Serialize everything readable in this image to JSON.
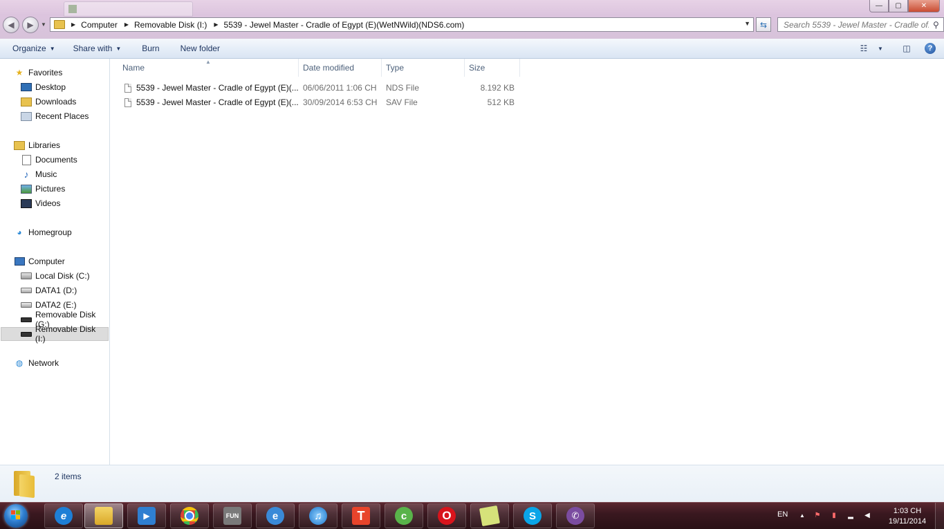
{
  "window": {
    "controls": {
      "minimize": "—",
      "maximize": "▢",
      "close": "✕"
    }
  },
  "address_bar": {
    "crumbs": [
      "Computer",
      "Removable Disk (I:)",
      "5539 - Jewel Master - Cradle of Egypt (E)(WetNWild)(NDS6.com)"
    ]
  },
  "search": {
    "placeholder": "Search 5539 - Jewel Master - Cradle of..."
  },
  "toolbar": {
    "organize": "Organize",
    "share_with": "Share with",
    "burn": "Burn",
    "new_folder": "New folder"
  },
  "nav_pane": {
    "favorites": "Favorites",
    "desktop": "Desktop",
    "downloads": "Downloads",
    "recent_places": "Recent Places",
    "libraries": "Libraries",
    "documents": "Documents",
    "music": "Music",
    "pictures": "Pictures",
    "videos": "Videos",
    "homegroup": "Homegroup",
    "computer": "Computer",
    "local_disk_c": "Local Disk (C:)",
    "data1_d": "DATA1 (D:)",
    "data2_e": "DATA2 (E:)",
    "removable_g": "Removable Disk (G:)",
    "removable_i": "Removable Disk (I:)",
    "network": "Network"
  },
  "columns": {
    "name": "Name",
    "date_modified": "Date modified",
    "type": "Type",
    "size": "Size"
  },
  "files": [
    {
      "name": "5539 - Jewel Master - Cradle of Egypt (E)(...",
      "date": "06/06/2011 1:06 CH",
      "type": "NDS File",
      "size": "8.192 KB"
    },
    {
      "name": "5539 - Jewel Master - Cradle of Egypt (E)(...",
      "date": "30/09/2014 6:53 CH",
      "type": "SAV File",
      "size": "512 KB"
    }
  ],
  "details": {
    "item_count": "2 items"
  },
  "taskbar": {
    "lang": "EN",
    "time": "1:03 CH",
    "date": "19/11/2014",
    "apps": [
      {
        "name": "internet-explorer",
        "glyph": "e",
        "color": "#1e7fd6"
      },
      {
        "name": "windows-explorer",
        "glyph": "",
        "color": "#e8c24f"
      },
      {
        "name": "media-player",
        "glyph": "▶",
        "color": "#2f7fd1"
      },
      {
        "name": "chrome",
        "glyph": "",
        "color": "#3cba54"
      },
      {
        "name": "fun-app",
        "glyph": "FUN",
        "color": "#7a7a7a"
      },
      {
        "name": "ie-alt",
        "glyph": "e",
        "color": "#3a8ad8"
      },
      {
        "name": "itunes",
        "glyph": "♫",
        "color": "#3b9be0"
      },
      {
        "name": "t-app",
        "glyph": "T",
        "color": "#e8442b"
      },
      {
        "name": "coccoc",
        "glyph": "c",
        "color": "#59b34a"
      },
      {
        "name": "opera",
        "glyph": "O",
        "color": "#d8141c"
      },
      {
        "name": "sticky-notes",
        "glyph": "",
        "color": "#d6e27a"
      },
      {
        "name": "skype",
        "glyph": "S",
        "color": "#0aa5e8"
      },
      {
        "name": "viber",
        "glyph": "✆",
        "color": "#7b4ca0"
      }
    ]
  }
}
